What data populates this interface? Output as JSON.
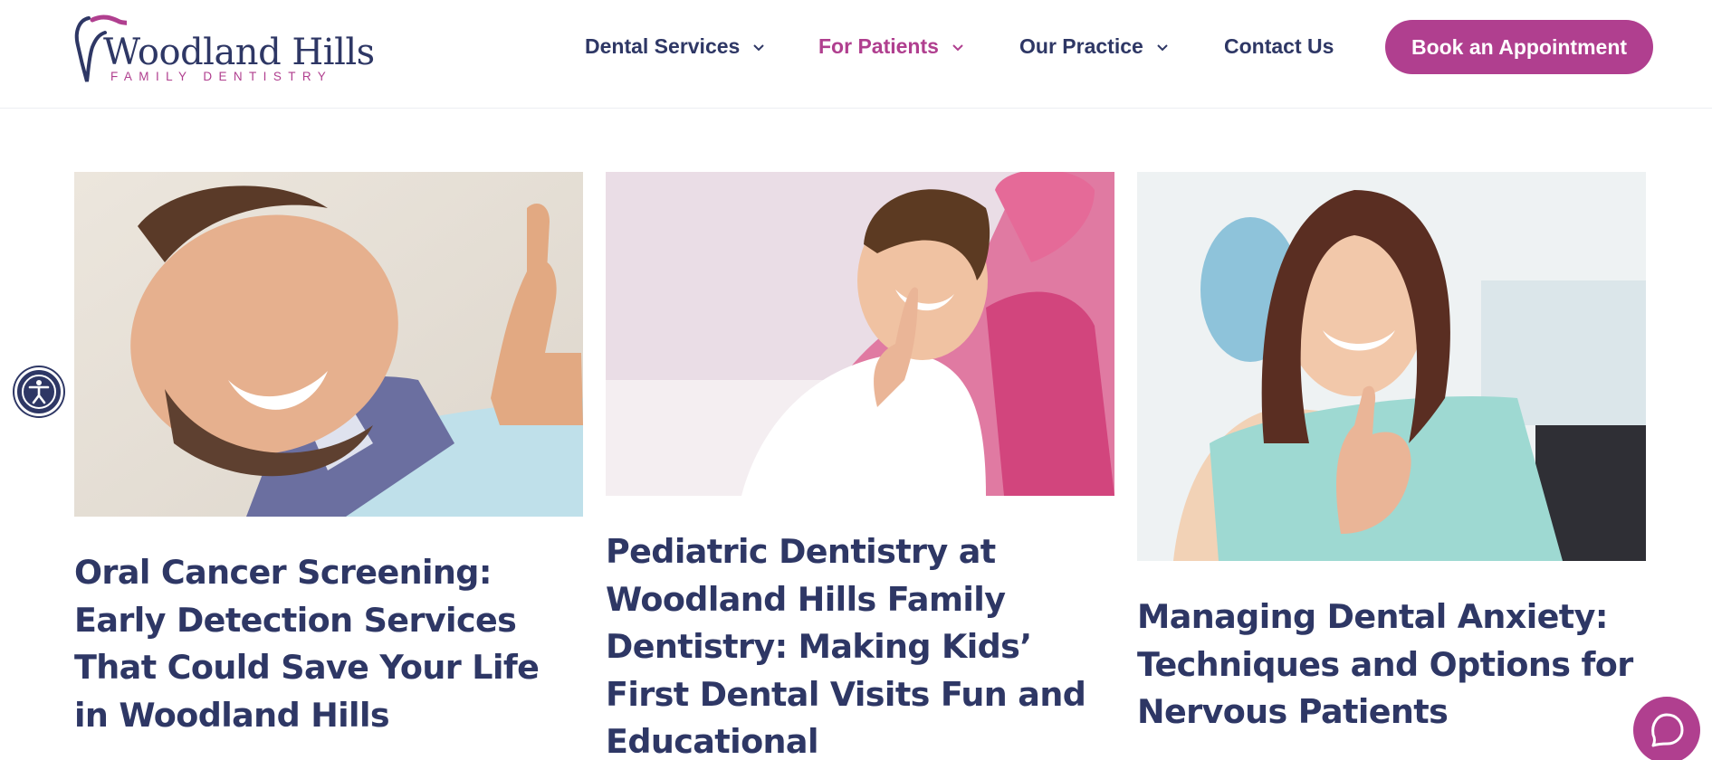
{
  "header": {
    "logo": {
      "brand": "Woodland Hills",
      "tagline": "FAMILY DENTISTRY"
    },
    "nav": [
      {
        "label": "Dental Services",
        "has_dropdown": true,
        "active": false
      },
      {
        "label": "For Patients",
        "has_dropdown": true,
        "active": true
      },
      {
        "label": "Our Practice",
        "has_dropdown": true,
        "active": false
      },
      {
        "label": "Contact Us",
        "has_dropdown": false,
        "active": false
      }
    ],
    "cta_label": "Book an Appointment"
  },
  "posts": [
    {
      "title": "Oral Cancer Screening: Early Detection Services That Could Save Your Life in Woodland Hills",
      "image": "smiling-man-thumbs-up-photo"
    },
    {
      "title": "Pediatric Dentistry at Woodland Hills Family Dentistry: Making Kids’ First Dental Visits Fun and Educational",
      "image": "smiling-boy-dental-chair-photo"
    },
    {
      "title": "Managing Dental Anxiety: Techniques and Options for Nervous Patients",
      "image": "smiling-woman-thumbs-up-photo"
    }
  ],
  "widgets": {
    "accessibility_icon": "accessibility-icon",
    "chat_icon": "chat-icon"
  },
  "colors": {
    "navy": "#2e3765",
    "magenta": "#b03f8f",
    "white": "#ffffff"
  }
}
